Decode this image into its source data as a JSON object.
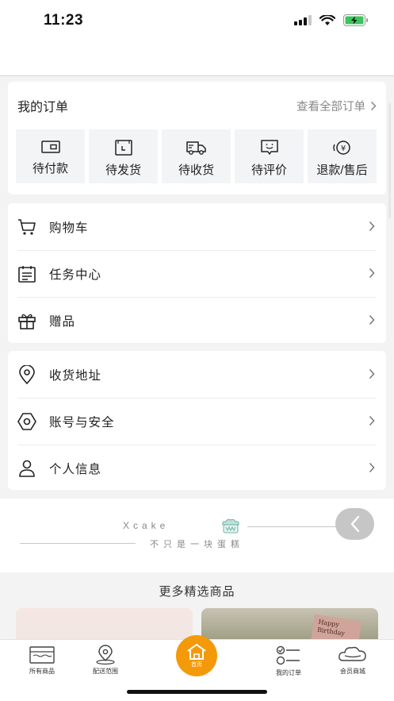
{
  "status_bar": {
    "time": "11:23"
  },
  "orders": {
    "title": "我的订单",
    "view_all": "查看全部订单",
    "items": [
      {
        "label": "待付款",
        "icon": "wallet-icon"
      },
      {
        "label": "待发货",
        "icon": "pending-ship-icon"
      },
      {
        "label": "待收货",
        "icon": "delivery-truck-icon"
      },
      {
        "label": "待评价",
        "icon": "review-icon"
      },
      {
        "label": "退款/售后",
        "icon": "refund-icon"
      }
    ]
  },
  "menu_group_1": [
    {
      "label": "购物车",
      "icon": "cart-icon"
    },
    {
      "label": "任务中心",
      "icon": "task-icon"
    },
    {
      "label": "赠品",
      "icon": "gift-icon"
    }
  ],
  "menu_group_2": [
    {
      "label": "收货地址",
      "icon": "location-icon"
    },
    {
      "label": "账号与安全",
      "icon": "settings-icon"
    },
    {
      "label": "个人信息",
      "icon": "user-icon"
    }
  ],
  "brand": {
    "name": "Xcake",
    "slogan": "不只是一块蛋糕"
  },
  "more_products": {
    "title": "更多精选商品",
    "card_text": "Happy Birthday"
  },
  "tab_bar": {
    "items": [
      {
        "label": "所有商品",
        "icon": "all-products-icon"
      },
      {
        "label": "配送范围",
        "icon": "delivery-range-icon"
      },
      {
        "label": "首页",
        "icon": "home-icon"
      },
      {
        "label": "我的订单",
        "icon": "my-orders-icon"
      },
      {
        "label": "会员商城",
        "icon": "member-mall-icon"
      }
    ]
  },
  "colors": {
    "accent": "#f49a0a",
    "background": "#f3f3f3",
    "tile": "#f3f4f6"
  }
}
